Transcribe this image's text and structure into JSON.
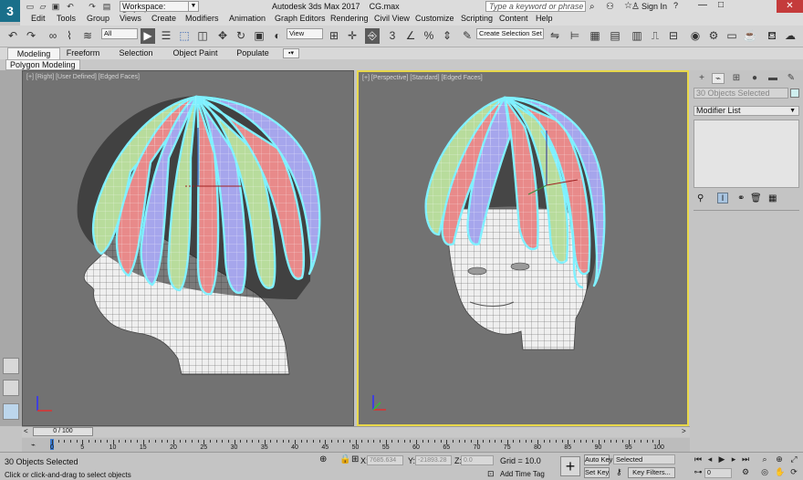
{
  "title_bar": {
    "app_title": "Autodesk 3ds Max 2017",
    "file_name": "CG.max",
    "workspace_label": "Workspace: Default",
    "search_placeholder": "Type a keyword or phrase",
    "sign_in": "Sign In"
  },
  "menu": [
    "Edit",
    "Tools",
    "Group",
    "Views",
    "Create",
    "Modifiers",
    "Animation",
    "Graph Editors",
    "Rendering",
    "Civil View",
    "Customize",
    "Scripting",
    "Content",
    "Help"
  ],
  "toolbar": {
    "selection_filter": "All",
    "reference_coord": "View",
    "named_selection": "Create Selection Set"
  },
  "ribbon": {
    "tabs": [
      "Modeling",
      "Freeform",
      "Selection",
      "Object Paint",
      "Populate"
    ],
    "subtab": "Polygon Modeling"
  },
  "viewports": {
    "left_label": "[+] [Right] [User Defined] [Edged Faces]",
    "right_label": "[+] [Perspective] [Standard] [Edged Faces]"
  },
  "command_panel": {
    "selection_name": "30 Objects Selected",
    "modifier_list": "Modifier List"
  },
  "time": {
    "frame_counter": "0 / 100",
    "ticks": [
      "0",
      "5",
      "10",
      "15",
      "20",
      "25",
      "30",
      "35",
      "40",
      "45",
      "50",
      "55",
      "60",
      "65",
      "70",
      "75",
      "80",
      "85",
      "90",
      "95",
      "100"
    ]
  },
  "status": {
    "selection": "30 Objects Selected",
    "prompt": "Click or click-and-drag to select objects",
    "x_label": "X:",
    "x_value": "7685.634",
    "y_label": "Y:",
    "y_value": "-21893.28",
    "z_label": "Z:",
    "z_value": "0.0",
    "grid": "Grid = 10.0",
    "add_time_tag": "Add Time Tag",
    "auto_key": "Auto Key",
    "set_key": "Set Key",
    "key_mode": "Selected",
    "key_filters": "Key Filters...",
    "current_frame": "0"
  },
  "colors": {
    "viewport_bg": "#727272",
    "active_viewport_border": "#e8d84a",
    "selection_outline": "#7ff0ff",
    "hair_red": "#e88a8a",
    "hair_green": "#b8dc9c",
    "hair_blue": "#a6a6ec"
  }
}
